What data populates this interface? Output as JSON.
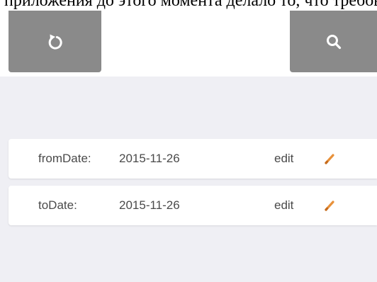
{
  "caption": {
    "text": "приложения до этого момента делало то, что требовалось."
  },
  "toolbar": {
    "refresh_icon": "refresh-icon",
    "search_icon": "search-icon",
    "button_color": "#8a8a8a",
    "rule_color": "#2d2f36"
  },
  "params": [
    {
      "label": "fromDate:",
      "value": "2015-11-26",
      "edit_label": "edit",
      "edit_icon": "pencil-icon"
    },
    {
      "label": "toDate:",
      "value": "2015-11-26",
      "edit_label": "edit",
      "edit_icon": "pencil-icon"
    }
  ],
  "colors": {
    "background": "#efeff4",
    "row_background": "#ffffff",
    "pencil": "#e8913a",
    "text": "#4a4a4a"
  }
}
